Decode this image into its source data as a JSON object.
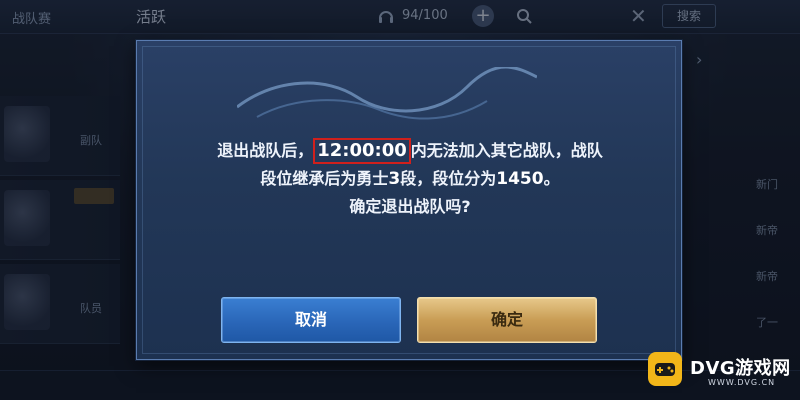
{
  "background": {
    "tab_left": "战队赛",
    "tab_active": "活跃",
    "player_count": "94/100",
    "plus_label": "+",
    "close_label": "✕",
    "search_button": "搜索",
    "left_rows": [
      "副队",
      "",
      "队员"
    ],
    "right_items": [
      "新门",
      "新帝",
      "新帝",
      "了一"
    ],
    "right_arrow": "›"
  },
  "dialog": {
    "message": {
      "line1_prefix": "退出战队后，",
      "time": "12:00:00",
      "line1_suffix": "内无法加入其它战队，战队",
      "line2_prefix": "段位继承后为勇士",
      "rank_num": "3",
      "line2_mid": "段，段位分为",
      "score": "1450",
      "line2_suffix": "。",
      "line3": "确定退出战队吗?"
    },
    "cancel_label": "取消",
    "confirm_label": "确定"
  },
  "watermark": {
    "title": "DVG游戏网",
    "subtitle": "WWW.DVG.CN"
  },
  "colors": {
    "highlight_box": "#d0201c",
    "cancel_button": "#2a66b8",
    "confirm_button": "#c99d55",
    "dialog_bg": "#223757",
    "watermark_badge": "#f2b619"
  }
}
